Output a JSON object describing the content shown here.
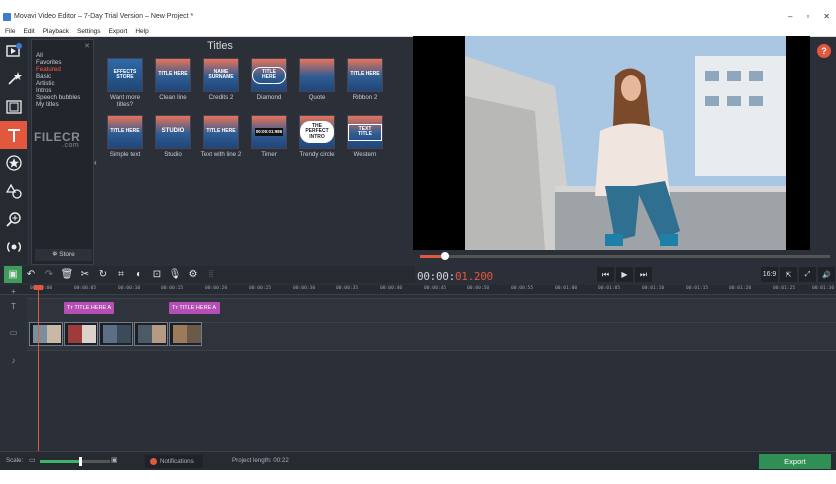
{
  "window": {
    "title": "Movavi Video Editor – 7-Day Trial Version – New Project *"
  },
  "menu": [
    "File",
    "Edit",
    "Playback",
    "Settings",
    "Export",
    "Help"
  ],
  "categories": {
    "items": [
      "All",
      "Favorites",
      "Featured",
      "Basic",
      "Artistic",
      "Intros",
      "Speech bubbles",
      "My titles"
    ],
    "selected": "Featured",
    "store_label": "Store"
  },
  "titles_panel": {
    "heading": "Titles",
    "items": [
      {
        "label": "Want more titles?",
        "thumb_text": "EFFECTS STORE"
      },
      {
        "label": "Clean line",
        "thumb_text": "TITLE HERE"
      },
      {
        "label": "Credits 2",
        "thumb_text": "Name Surname"
      },
      {
        "label": "Diamond",
        "thumb_text": "TITLE HERE"
      },
      {
        "label": "Quote",
        "thumb_text": ""
      },
      {
        "label": "Ribbon 2",
        "thumb_text": "TITLE HERE"
      },
      {
        "label": "Simple text",
        "thumb_text": "TITLE HERE"
      },
      {
        "label": "Studio",
        "thumb_text": "STUDIO"
      },
      {
        "label": "Text with line 2",
        "thumb_text": "TITLE HERE"
      },
      {
        "label": "Timer",
        "thumb_text": "00:00:01:986"
      },
      {
        "label": "Trendy circle",
        "thumb_text": "THE PERFECT INTRO"
      },
      {
        "label": "Western",
        "thumb_text": "TEXT TITLE"
      }
    ]
  },
  "watermark": {
    "text": "FILECR",
    "sub": ".com"
  },
  "player": {
    "timecode_main": "00:00:",
    "timecode_accent": "01.200",
    "progress": 0.06,
    "aspect_label": "16:9",
    "help": "?"
  },
  "ruler_ticks": [
    "00:00:00",
    "00:00:05",
    "00:00:10",
    "00:00:15",
    "00:00:20",
    "00:00:25",
    "00:00:30",
    "00:00:35",
    "00:00:40",
    "00:00:45",
    "00:00:50",
    "00:00:55",
    "00:01:00",
    "00:01:05",
    "00:01:10",
    "00:01:15",
    "00:01:20",
    "00:01:25",
    "00:01:30"
  ],
  "title_clips": [
    {
      "label": "TITLE HERE A"
    },
    {
      "label": "TITLE HERE A"
    }
  ],
  "statusbar": {
    "scale_label": "Scale:",
    "notifications": "Notifications",
    "project_length_label": "Project length:",
    "project_length": "00:22",
    "export_label": "Export"
  },
  "colors": {
    "accent": "#e2583e",
    "export": "#2f8f55",
    "title_clip": "#b54fb5",
    "background": "#2b2f38"
  }
}
